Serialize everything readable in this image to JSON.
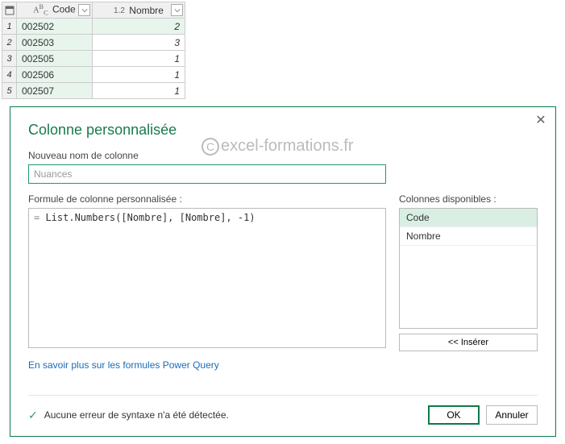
{
  "table": {
    "columns": [
      {
        "type_label": "ABC",
        "name": "Code"
      },
      {
        "type_label": "1.2",
        "name": "Nombre"
      }
    ],
    "rows": [
      {
        "n": "1",
        "code": "002502",
        "nombre": "2"
      },
      {
        "n": "2",
        "code": "002503",
        "nombre": "3"
      },
      {
        "n": "3",
        "code": "002505",
        "nombre": "1"
      },
      {
        "n": "4",
        "code": "002506",
        "nombre": "1"
      },
      {
        "n": "5",
        "code": "002507",
        "nombre": "1"
      }
    ]
  },
  "dialog": {
    "title": "Colonne personnalisée",
    "new_col_label": "Nouveau nom de colonne",
    "new_col_value": "Nuances",
    "formula_label": "Formule de colonne personnalisée :",
    "formula_prefix": "= ",
    "formula_value": "List.Numbers([Nombre], [Nombre], -1)",
    "avail_label": "Colonnes disponibles :",
    "avail_items": [
      "Code",
      "Nombre"
    ],
    "insert_label": "<< Insérer",
    "learn_link": "En savoir plus sur les formules Power Query",
    "status_text": "Aucune erreur de syntaxe n'a été détectée.",
    "ok_label": "OK",
    "cancel_label": "Annuler"
  },
  "watermark": "excel-formations.fr"
}
